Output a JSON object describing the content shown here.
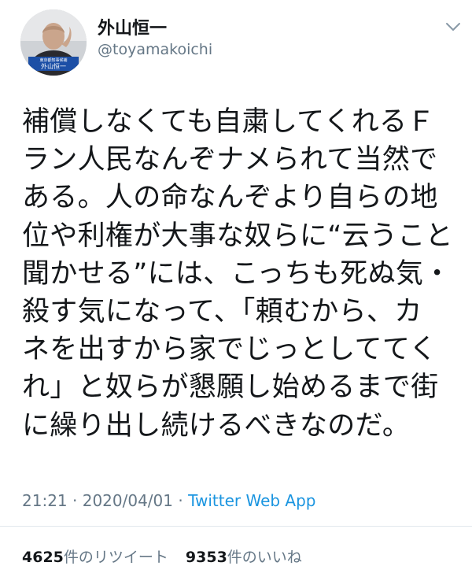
{
  "profile": {
    "display_name": "外山恒一",
    "handle": "@toyamakoichi",
    "avatar_badge_small": "東京都知事候補",
    "avatar_badge_name": "外山恒一"
  },
  "tweet": {
    "lines": [
      "補償しなくても自粛してくれるＦ",
      "ラン人民なんぞナメられて当然で",
      "ある。人の命なんぞより自らの地",
      "位や利権が大事な奴らに“云うこと",
      "聞かせる”には、こっちも死ぬ気・",
      "殺す気になって、「頼むから、カ",
      "ネを出すから家でじっとしててく",
      "れ」と奴らが懇願し始めるまで街",
      "に繰り出し続けるべきなのだ。"
    ],
    "time": "21:21",
    "separator": "·",
    "date": "2020/04/01",
    "source": "Twitter Web App"
  },
  "stats": {
    "retweets_count": "4625",
    "retweets_label": "件のリツイート",
    "likes_count": "9353",
    "likes_label": "件のいいね"
  },
  "colors": {
    "text": "#14171a",
    "secondary": "#657786",
    "link": "#1b95e0",
    "divider": "#e1e8ed"
  },
  "icons": {
    "menu": "chevron-down-icon"
  }
}
